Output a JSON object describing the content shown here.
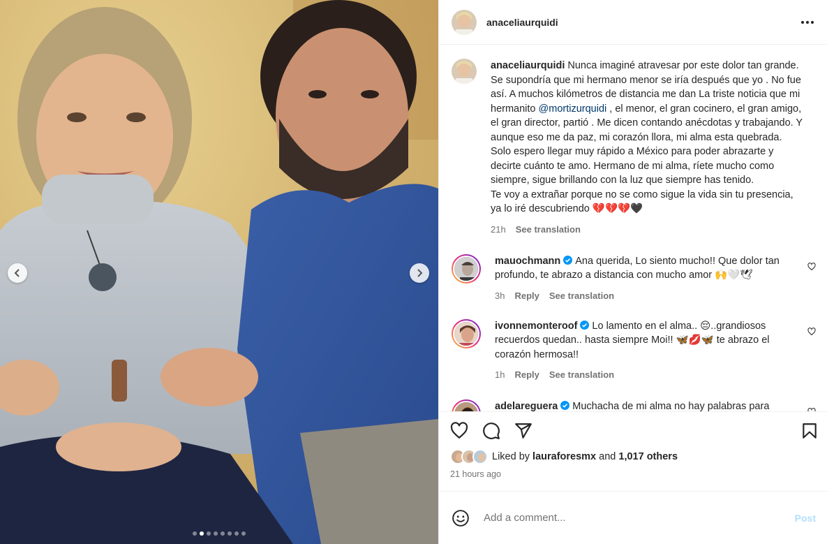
{
  "header": {
    "username": "anaceliaurquidi",
    "more_icon": "more-horizontal-icon"
  },
  "media": {
    "prev_icon": "chevron-left-icon",
    "next_icon": "chevron-right-icon",
    "slide_count": 8,
    "active_slide": 2
  },
  "caption": {
    "username": "anaceliaurquidi",
    "text_before_mention": "Nunca imaginé atravesar por este dolor tan grande. Se supondría que mi hermano menor se iría después que yo . No fue así. A muchos kilómetros de distancia me dan La triste noticia que mi hermanito ",
    "mention": "@mortizurquidi",
    "text_after_mention": " , el menor, el gran cocinero, el gran amigo, el gran director, partió . Me dicen contando anécdotas y trabajando. Y aunque eso me da paz, mi corazón llora, mi alma esta quebrada. Solo espero llegar muy rápido a México para poder abrazarte y decirte cuánto te amo. Hermano de mi alma, ríete mucho como siempre, sigue brillando con la luz que siempre has tenido.",
    "text_second": "Te voy a extrañar porque no se como sigue la vida sin tu presencia, ya lo iré descubriendo 💔💔💔🖤",
    "time": "21h",
    "see_translation": "See translation"
  },
  "comments": [
    {
      "username": "mauochmann",
      "verified": true,
      "text": "Ana querida, Lo siento mucho!! Que dolor tan profundo, te abrazo a distancia con mucho amor 🙌🤍🕊",
      "time": "3h",
      "reply": "Reply",
      "see_translation": "See translation"
    },
    {
      "username": "ivonnemonteroof",
      "verified": true,
      "text": "Lo lamento en el alma.. 😔..grandiosos recuerdos quedan.. hasta siempre Moi!! 🦋💋🦋 te abrazo el corazón hermosa!!",
      "time": "1h",
      "reply": "Reply",
      "see_translation": "See translation"
    },
    {
      "username": "adelareguera",
      "verified": true,
      "text": "Muchacha de mi alma no hay palabras para"
    }
  ],
  "actions": {
    "like_icon": "heart-icon",
    "comment_icon": "comment-icon",
    "share_icon": "share-icon",
    "save_icon": "bookmark-icon"
  },
  "likes": {
    "prefix": "Liked by ",
    "user": "lauraforesmx",
    "conjunction": " and ",
    "others": "1,017 others"
  },
  "post_time": "21 hours ago",
  "add_comment": {
    "placeholder": "Add a comment...",
    "post_label": "Post",
    "emoji_icon": "emoji-icon"
  },
  "colors": {
    "link": "#00376b",
    "muted": "#737373",
    "verified": "#0095f6",
    "post_disabled": "#b2dffc"
  }
}
